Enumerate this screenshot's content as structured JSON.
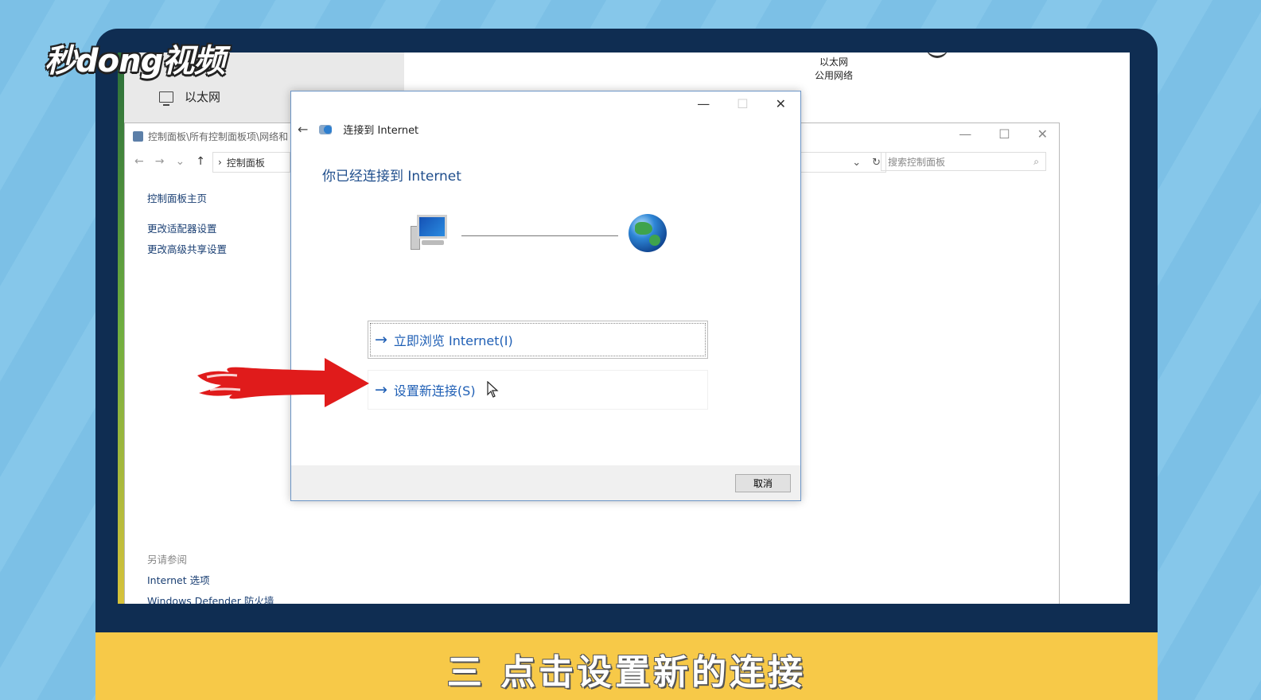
{
  "logo": {
    "text": "秒dong视频"
  },
  "caption": {
    "text": "三 点击设置新的连接"
  },
  "settings": {
    "ethernet_item": "以太网",
    "top_name": "以太网",
    "top_status": "公用网络"
  },
  "control_panel": {
    "title": "控制面板\\所有控制面板项\\网络和",
    "address": "控制面板",
    "search_placeholder": "搜索控制面板",
    "sidebar": [
      {
        "label": "控制面板主页"
      },
      {
        "label": "更改适配器设置"
      },
      {
        "label": "更改高级共享设置"
      }
    ],
    "see_also_title": "另请参阅",
    "see_also": [
      {
        "label": "Internet 选项"
      },
      {
        "label": "Windows Defender 防火墙"
      }
    ]
  },
  "dialog": {
    "header": "连接到 Internet",
    "main_title": "你已经连接到 Internet",
    "option_browse": "立即浏览 Internet(I)",
    "option_setup": "设置新连接(S)",
    "cancel": "取消"
  },
  "colors": {
    "laptop_frame": "#0f2d52",
    "caption_bar": "#f7c948",
    "link_blue": "#1f5fb5",
    "annotation_red": "#e01b1b"
  }
}
